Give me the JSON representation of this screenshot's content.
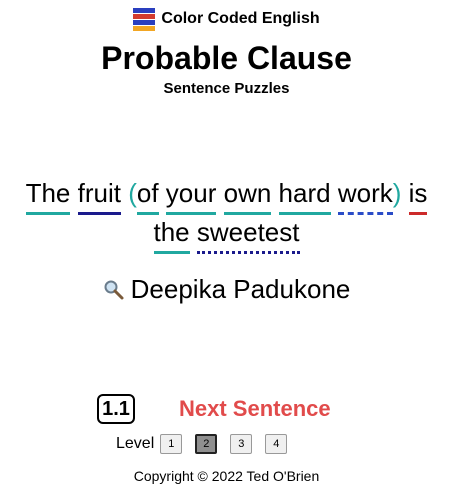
{
  "brand": {
    "label": "Color Coded English",
    "flag_colors": [
      "#2a3fbf",
      "#d23b2f",
      "#2a3fbf",
      "#f2a623"
    ]
  },
  "header": {
    "title": "Probable Clause",
    "subtitle": "Sentence Puzzles"
  },
  "sentence": {
    "w1": "The",
    "w2": "fruit",
    "open_paren": "(",
    "w3": "of",
    "w4": "your",
    "w5": "own",
    "w6": "hard",
    "w7": "work",
    "close_paren": ")",
    "w8": "is",
    "w9": "the",
    "w10": "sweetest"
  },
  "author": {
    "icon": "magnifier-icon",
    "name": "Deepika Padukone"
  },
  "progress": {
    "level_number": "1.1",
    "next_label": "Next Sentence"
  },
  "levels": {
    "label": "Level",
    "buttons": [
      "1",
      "2",
      "3",
      "4"
    ],
    "selected": "2"
  },
  "footer": {
    "copyright": "Copyright © 2022 Ted O'Brien"
  }
}
